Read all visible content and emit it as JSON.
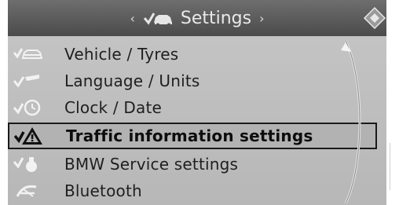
{
  "header": {
    "title": "Settings",
    "left_arrow": "‹",
    "right_arrow": "›",
    "title_icon": "car-check-icon",
    "control_icon": "navigation-diamond-icon"
  },
  "menu": {
    "items": [
      {
        "label": "Vehicle / Tyres",
        "icon": "vehicle-check-icon",
        "selected": false
      },
      {
        "label": "Language / Units",
        "icon": "language-check-icon",
        "selected": false
      },
      {
        "label": "Clock / Date",
        "icon": "clock-check-icon",
        "selected": false
      },
      {
        "label": "Traffic information settings",
        "icon": "traffic-warning-icon",
        "selected": true
      },
      {
        "label": "BMW Service settings",
        "icon": "service-check-icon",
        "selected": false
      },
      {
        "label": "Bluetooth",
        "icon": "bluetooth-icon",
        "selected": false
      }
    ]
  },
  "colors": {
    "header_bg": "#4b4b4b",
    "list_bg": "#c0c0c0",
    "text": "#1f1f1f",
    "selected_border": "#1a1a1a"
  }
}
